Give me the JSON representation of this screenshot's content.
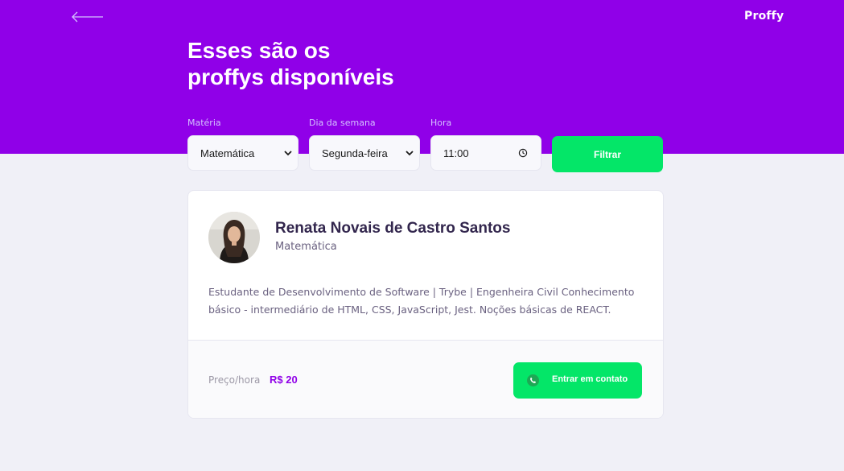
{
  "header": {
    "logo": "Proffy",
    "title_line1": "Esses são os",
    "title_line2": "proffys disponíveis"
  },
  "filters": {
    "subject": {
      "label": "Matéria",
      "value": "Matemática"
    },
    "weekday": {
      "label": "Dia da semana",
      "value": "Segunda-feira"
    },
    "time": {
      "label": "Hora",
      "value": "11:00"
    },
    "button": "Filtrar"
  },
  "teacher": {
    "name": "Renata Novais de Castro Santos",
    "subject": "Matemática",
    "bio": "Estudante de Desenvolvimento de Software | Trybe | Engenheira Civil Conhecimento básico - intermediário de HTML, CSS, JavaScript, Jest. Noções básicas de REACT.",
    "price_label": "Preço/hora",
    "price": "R$ 20",
    "contact_button": "Entrar em contato"
  },
  "icons": {
    "back": "arrow-left-icon",
    "select": "chevron-down-icon",
    "time": "clock-icon",
    "contact": "whatsapp-icon"
  },
  "colors": {
    "primary": "#9000e8",
    "secondary": "#04e668",
    "background": "#f0f0f7",
    "title_dark": "#32264d"
  }
}
